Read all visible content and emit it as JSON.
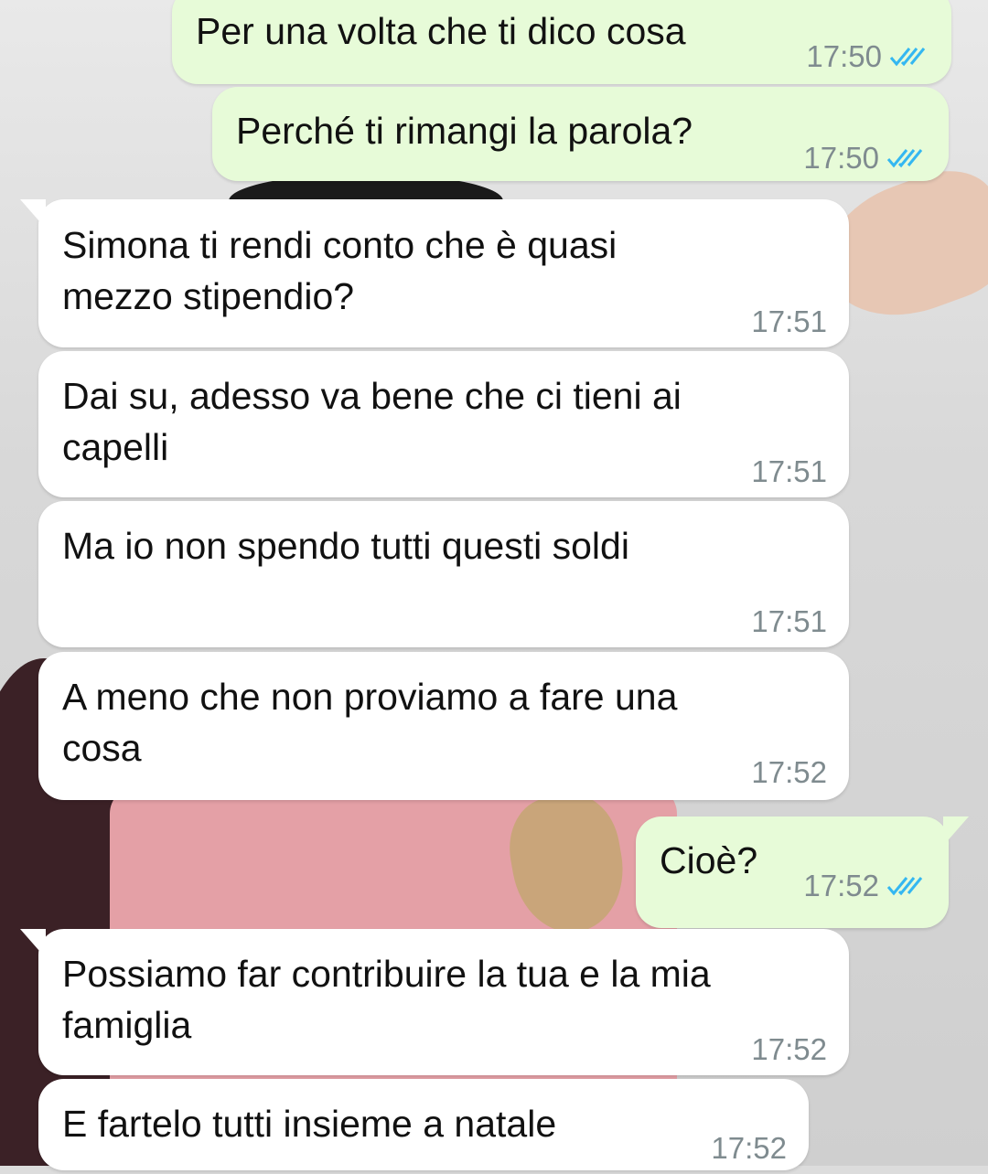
{
  "messages": [
    {
      "direction": "out",
      "text": "Per una volta che ti dico cosa",
      "time": "17:50",
      "status_icon": "double-check-read-icon"
    },
    {
      "direction": "out",
      "text": "Perché ti rimangi la parola?",
      "time": "17:50",
      "status_icon": "double-check-read-icon"
    },
    {
      "direction": "in",
      "text": "Simona ti rendi conto che è quasi\nmezzo stipendio?",
      "time": "17:51"
    },
    {
      "direction": "in",
      "text": "Dai su, adesso va bene che ci tieni ai\ncapelli",
      "time": "17:51"
    },
    {
      "direction": "in",
      "text": "Ma io non spendo tutti questi soldi",
      "time": "17:51"
    },
    {
      "direction": "in",
      "text": "A meno che non proviamo a fare una\ncosa",
      "time": "17:52"
    },
    {
      "direction": "out",
      "text": "Cioè?",
      "time": "17:52",
      "status_icon": "double-check-read-icon"
    },
    {
      "direction": "in",
      "text": "Possiamo far contribuire la tua e la mia\nfamiglia",
      "time": "17:52"
    },
    {
      "direction": "in",
      "text": "E fartelo tutti insieme a natale",
      "time": "17:52"
    }
  ],
  "colors": {
    "outgoing_bubble": "#e7fbd8",
    "incoming_bubble": "#ffffff",
    "read_tick": "#34b7f1",
    "time_text": "#7f8b8f"
  }
}
